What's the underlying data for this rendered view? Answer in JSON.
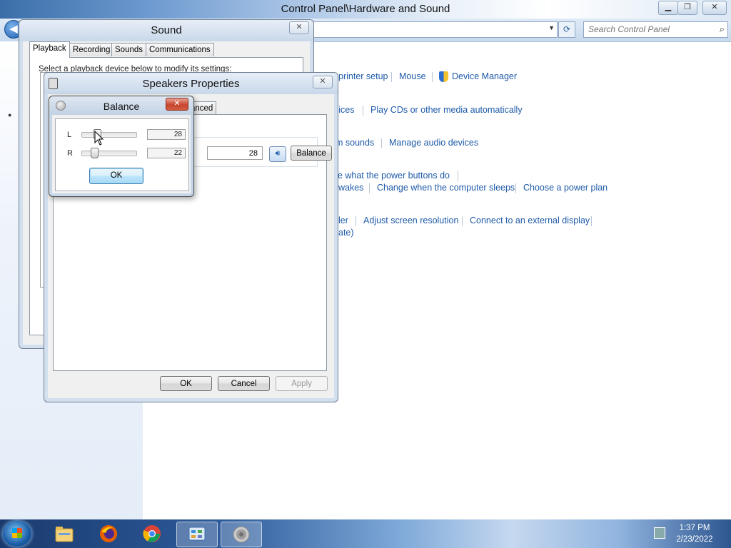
{
  "control_panel": {
    "title": "Control Panel\\Hardware and Sound",
    "search_placeholder": "Search Control Panel",
    "links": [
      {
        "id": "printer-setup",
        "label": "printer setup"
      },
      {
        "id": "mouse",
        "label": "Mouse"
      },
      {
        "id": "device-manager",
        "label": "Device Manager"
      },
      {
        "id": "vices",
        "label": "vices"
      },
      {
        "id": "play-cds",
        "label": "Play CDs or other media automatically"
      },
      {
        "id": "m-sounds",
        "label": "m sounds"
      },
      {
        "id": "manage-audio",
        "label": "Manage audio devices"
      },
      {
        "id": "power-buttons",
        "label": "ge what the power buttons do"
      },
      {
        "id": "wakes",
        "label": "wakes"
      },
      {
        "id": "computer-sleeps",
        "label": "Change when the computer sleeps"
      },
      {
        "id": "power-plan",
        "label": "Choose a power plan"
      },
      {
        "id": "ler",
        "label": "ler"
      },
      {
        "id": "screen-resolution",
        "label": "Adjust screen resolution"
      },
      {
        "id": "external-display",
        "label": "Connect to an external display"
      },
      {
        "id": "ate",
        "label": "ate)"
      }
    ]
  },
  "sound_dialog": {
    "title": "Sound",
    "tabs": [
      "Playback",
      "Recording",
      "Sounds",
      "Communications"
    ],
    "active_tab": "Playback",
    "description": "Select a playback device below to modify its settings:"
  },
  "speakers_dialog": {
    "title": "Speakers Properties",
    "partial_tab": "anced",
    "level_value": "28",
    "balance_button": "Balance",
    "ok": "OK",
    "cancel": "Cancel",
    "apply": "Apply"
  },
  "balance_dialog": {
    "title": "Balance",
    "channels": [
      {
        "label": "L",
        "value": "28",
        "level": 0.28
      },
      {
        "label": "R",
        "value": "22",
        "level": 0.22
      }
    ],
    "ok": "OK"
  },
  "taskbar": {
    "apps": [
      "explorer-icon",
      "firefox-icon",
      "chrome-icon",
      "control-panel-icon",
      "speaker-icon"
    ],
    "time": "1:37 PM",
    "date": "2/23/2022"
  }
}
